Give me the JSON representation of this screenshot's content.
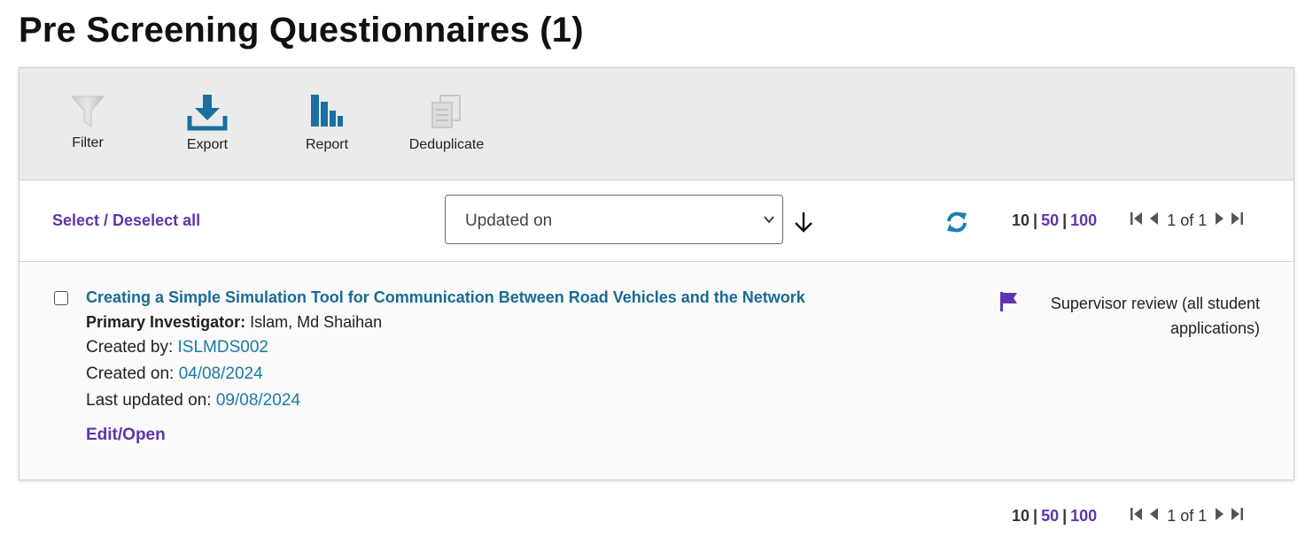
{
  "page": {
    "title": "Pre Screening Questionnaires (1)"
  },
  "toolbar": {
    "filter_label": "Filter",
    "export_label": "Export",
    "report_label": "Report",
    "deduplicate_label": "Deduplicate"
  },
  "controls": {
    "select_all_label": "Select / Deselect all",
    "sort_selected": "Updated on",
    "sort_direction_icon": "arrow-down-icon"
  },
  "pager": {
    "sizes": [
      "10",
      "50",
      "100"
    ],
    "active_size": "10",
    "separator": "|",
    "page_info": "1 of 1"
  },
  "record": {
    "title": "Creating a Simple Simulation Tool for Communication Between Road Vehicles and the Network",
    "pi_label": "Primary Investigator:",
    "pi_value": "Islam, Md Shaihan",
    "created_by_label": "Created by:",
    "created_by_value": "ISLMDS002",
    "created_on_label": "Created on:",
    "created_on_value": "04/08/2024",
    "last_updated_label": "Last updated on:",
    "last_updated_value": "09/08/2024",
    "edit_label": "Edit/Open",
    "status": "Supervisor review (all student applications)"
  },
  "colors": {
    "link_purple": "#5f35ae",
    "link_blue": "#1a6a94",
    "icon_blue": "#1a6fa0",
    "toolbar_bg": "#ebebeb"
  }
}
